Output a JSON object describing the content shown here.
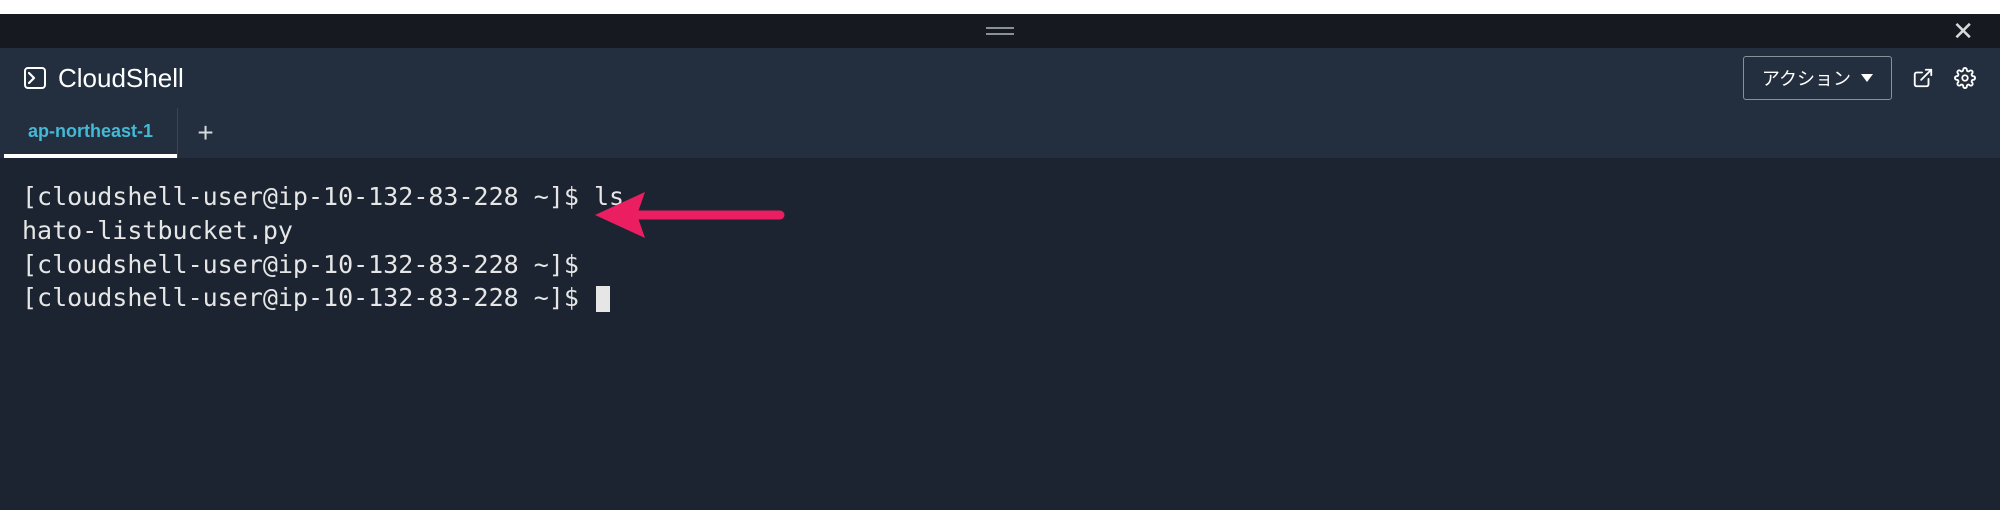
{
  "header": {
    "title": "CloudShell",
    "actions_label": "アクション"
  },
  "tabs": {
    "items": [
      {
        "label": "ap-northeast-1",
        "active": true
      }
    ]
  },
  "terminal": {
    "lines": [
      "[cloudshell-user@ip-10-132-83-228 ~]$ ls",
      "hato-listbucket.py",
      "[cloudshell-user@ip-10-132-83-228 ~]$",
      "[cloudshell-user@ip-10-132-83-228 ~]$ "
    ]
  },
  "annotation": {
    "arrow_color": "#ec1e62"
  }
}
